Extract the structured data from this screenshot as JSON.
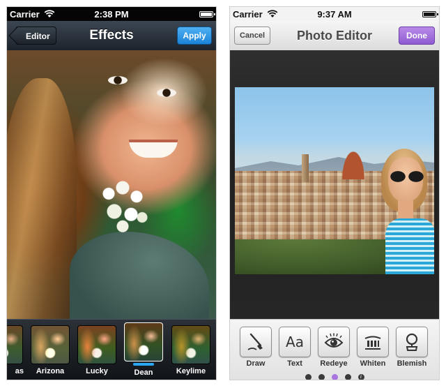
{
  "left": {
    "status": {
      "carrier": "Carrier",
      "time": "2:38 PM"
    },
    "nav": {
      "back_label": "Editor",
      "title": "Effects",
      "apply_label": "Apply"
    },
    "effects": [
      {
        "label": "as",
        "selected": false
      },
      {
        "label": "Arizona",
        "selected": false
      },
      {
        "label": "Lucky",
        "selected": false
      },
      {
        "label": "Dean",
        "selected": true
      },
      {
        "label": "Keylime",
        "selected": false
      }
    ]
  },
  "right": {
    "status": {
      "carrier": "Carrier",
      "time": "9:37 AM"
    },
    "nav": {
      "cancel_label": "Cancel",
      "title": "Photo Editor",
      "done_label": "Done"
    },
    "tools": [
      {
        "label": "Draw",
        "icon": "draw-icon"
      },
      {
        "label": "Text",
        "icon": "text-icon",
        "glyph": "Aa"
      },
      {
        "label": "Redeye",
        "icon": "redeye-icon"
      },
      {
        "label": "Whiten",
        "icon": "whiten-icon"
      },
      {
        "label": "Blemish",
        "icon": "blemish-icon"
      }
    ],
    "page_dots": {
      "count": 4,
      "active_index": 2,
      "has_info": true
    }
  },
  "colors": {
    "apply_blue": "#1a82d7",
    "done_purple": "#8e5bd1",
    "selected_effect": "#29a7f0",
    "active_dot": "#a874e0"
  }
}
